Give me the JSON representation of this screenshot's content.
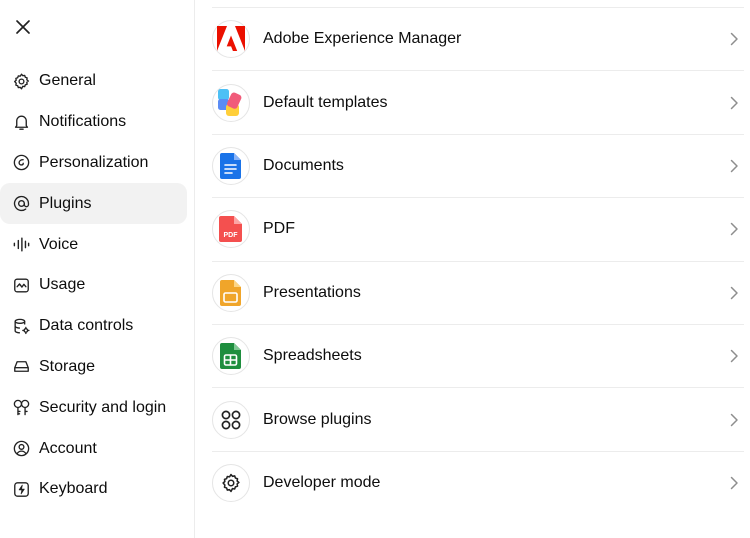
{
  "sidebar": {
    "items": [
      {
        "label": "General",
        "icon": "gear-icon"
      },
      {
        "label": "Notifications",
        "icon": "bell-icon"
      },
      {
        "label": "Personalization",
        "icon": "personalization-icon"
      },
      {
        "label": "Plugins",
        "icon": "at-sign-icon",
        "active": true
      },
      {
        "label": "Voice",
        "icon": "waveform-icon"
      },
      {
        "label": "Usage",
        "icon": "usage-chart-icon"
      },
      {
        "label": "Data controls",
        "icon": "database-gear-icon"
      },
      {
        "label": "Storage",
        "icon": "storage-drive-icon"
      },
      {
        "label": "Security and login",
        "icon": "keys-icon"
      },
      {
        "label": "Account",
        "icon": "user-circle-icon"
      },
      {
        "label": "Keyboard",
        "icon": "keyboard-bolt-icon"
      }
    ]
  },
  "plugins": {
    "items": [
      {
        "label": "Adobe Experience Manager",
        "icon": "adobe-logo-icon"
      },
      {
        "label": "Default templates",
        "icon": "templates-icon"
      },
      {
        "label": "Documents",
        "icon": "document-icon"
      },
      {
        "label": "PDF",
        "icon": "pdf-icon",
        "badge": "PDF"
      },
      {
        "label": "Presentations",
        "icon": "presentation-icon"
      },
      {
        "label": "Spreadsheets",
        "icon": "spreadsheet-icon"
      },
      {
        "label": "Browse plugins",
        "icon": "grid-circles-icon"
      },
      {
        "label": "Developer mode",
        "icon": "gear-icon"
      }
    ]
  },
  "colors": {
    "active_bg": "#f2f2f2",
    "divider": "#ececec",
    "adobe_red": "#eb1000",
    "docs_blue": "#1a73e8",
    "pdf_red": "#f4504f",
    "slides_orange": "#f0a52a",
    "sheets_green": "#1e8e3e"
  }
}
